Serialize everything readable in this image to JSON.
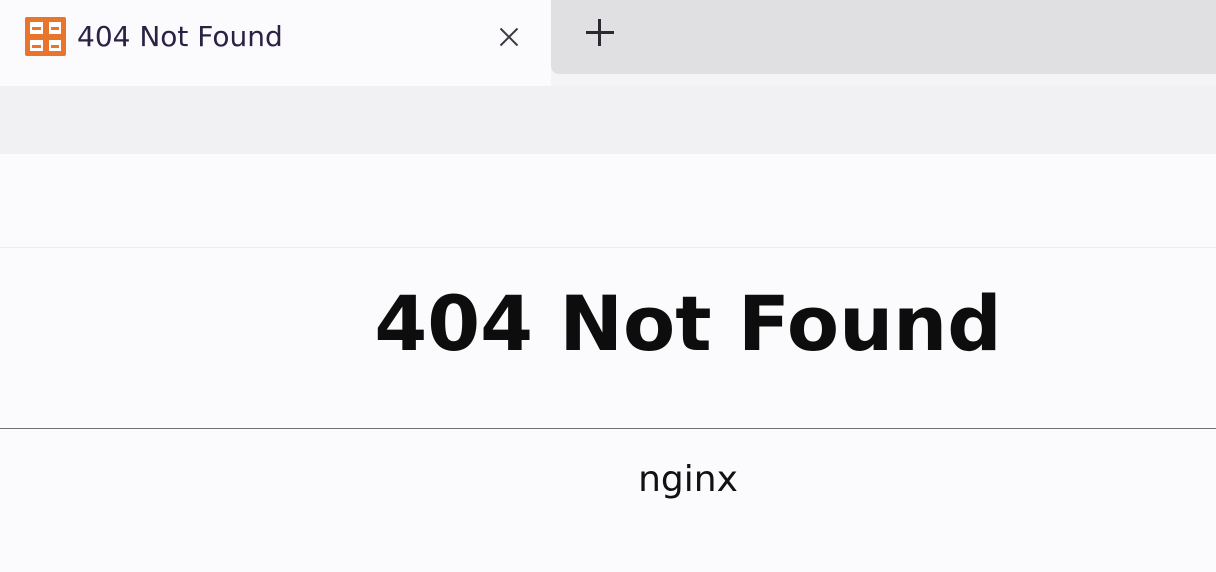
{
  "tab": {
    "title": "404 Not Found",
    "favicon_icon": "4399-logo-icon",
    "close_icon": "close-icon",
    "new_tab_icon": "plus-icon"
  },
  "page": {
    "heading": "404 Not Found",
    "footer": "nginx"
  },
  "colors": {
    "favicon_orange": "#e9742b",
    "tab_title": "#2a2145",
    "heading": "#0d0d0d"
  }
}
